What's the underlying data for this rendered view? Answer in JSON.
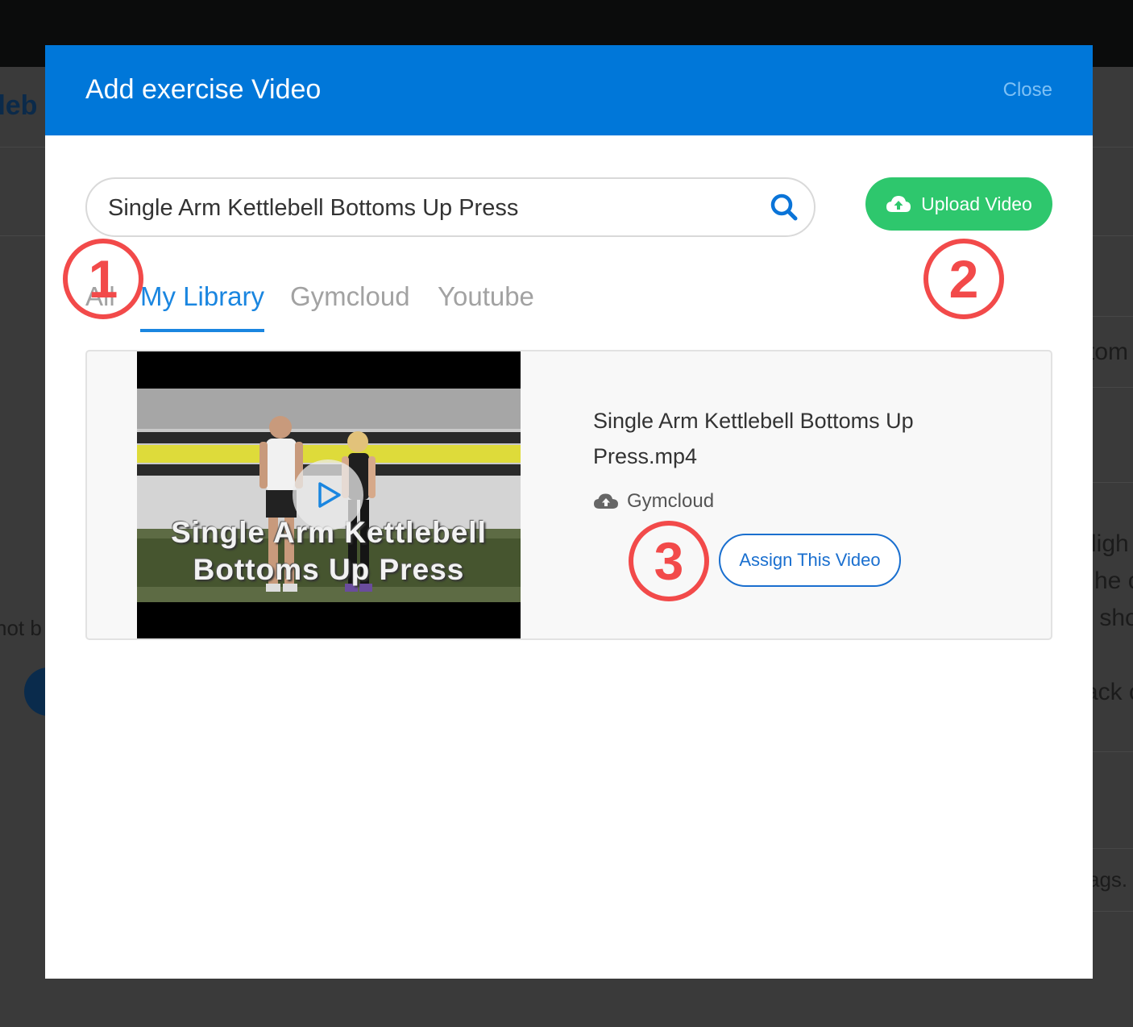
{
  "background": {
    "title_fragment": "tleb",
    "fragments": [
      "tom",
      "ligh",
      "he c",
      "r sho",
      "ack c",
      "ags.",
      "not b"
    ]
  },
  "modal": {
    "title": "Add exercise Video",
    "close_label": "Close",
    "search": {
      "value": "Single Arm Kettlebell Bottoms Up Press",
      "placeholder": ""
    },
    "upload_label": "Upload Video",
    "tabs": [
      {
        "label": "All",
        "active": false
      },
      {
        "label": "My Library",
        "active": true
      },
      {
        "label": "Gymcloud",
        "active": false
      },
      {
        "label": "Youtube",
        "active": false
      }
    ],
    "result": {
      "thumbnail_caption_line1": "Single Arm Kettlebell",
      "thumbnail_caption_line2": "Bottoms Up Press",
      "file_name": "Single Arm Kettlebell Bottoms Up Press.mp4",
      "source_label": "Gymcloud",
      "assign_label": "Assign This Video"
    }
  },
  "annotations": [
    "1",
    "2",
    "3"
  ],
  "colors": {
    "header": "#0077d9",
    "upload_button": "#2ec76d",
    "active_tab": "#1a86e0",
    "annotation": "#f24a4a"
  },
  "icons": {
    "search": "search-icon",
    "upload": "cloud-upload-icon",
    "source": "cloud-icon",
    "play": "play-icon"
  }
}
